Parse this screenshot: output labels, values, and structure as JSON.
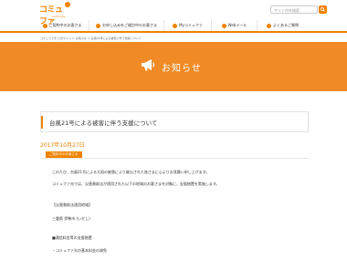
{
  "header": {
    "logo_text": "コミュファ",
    "logo_sub": "commufa",
    "search_placeholder": "サイト内を検索"
  },
  "nav": {
    "items": [
      {
        "label": "ご契約中のお客さま"
      },
      {
        "label": "お申し込みをご検討中のお客さま"
      },
      {
        "label": "Myコミュファ"
      },
      {
        "label": "Webメール"
      },
      {
        "label": "よくあるご質問"
      }
    ]
  },
  "breadcrumb": "コミュファ光 公式サイト ＞ お知らせ ＞ 台風21号による被害に伴う支援について",
  "banner": {
    "title": "お知らせ"
  },
  "article": {
    "title": "台風21号による被害に伴う支援について",
    "date": "2017年10月27日",
    "category": "ご契約中のお客さま",
    "lines": [
      "このたび、台風21号による大雨の被害により被災された皆さまに心よりお見舞い申し上げます。",
      "コミュファ光では、災害救助法が適用された以下の地域のお客さまを対象に、支援措置を実施します。",
      "【災害救助法適用地域】",
      "三重県 伊勢市 (いせし)",
      "■通信料金等の支援措置",
      "・コミュファ光の基本料金の減免"
    ]
  }
}
